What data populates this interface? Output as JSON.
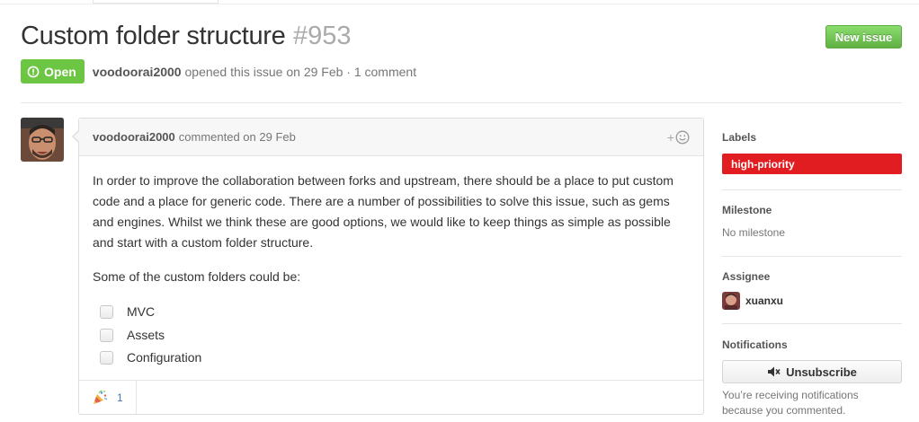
{
  "issue": {
    "title": "Custom folder structure",
    "number": "#953",
    "state": "Open",
    "author": "voodoorai2000",
    "opened_text": "opened this issue on 29 Feb · 1 comment"
  },
  "header": {
    "new_issue_label": "New issue"
  },
  "comment": {
    "author": "voodoorai2000",
    "meta": "commented on 29 Feb",
    "paragraphs": [
      "In order to improve the collaboration between forks and upstream, there should be a place to put custom code and a place for generic code. There are a number of possibilities to solve this issue, such as gems and engines. Whilst we think these are good options, we would like to keep things as simple as possible and start with a custom folder structure.",
      "Some of the custom folders could be:"
    ],
    "tasks": [
      {
        "label": "MVC",
        "checked": false
      },
      {
        "label": "Assets",
        "checked": false
      },
      {
        "label": "Configuration",
        "checked": false
      }
    ],
    "reaction_plus": "+",
    "reactions": [
      {
        "icon": "tada-icon",
        "count": "1"
      }
    ]
  },
  "sidebar": {
    "labels": {
      "heading": "Labels",
      "items": [
        {
          "name": "high-priority",
          "color": "#e11d21"
        }
      ]
    },
    "milestone": {
      "heading": "Milestone",
      "value": "No milestone"
    },
    "assignee": {
      "heading": "Assignee",
      "name": "xuanxu"
    },
    "notifications": {
      "heading": "Notifications",
      "button_label": "Unsubscribe",
      "reason": "You’re receiving notifications because you commented."
    }
  },
  "colors": {
    "open_green": "#6cc644",
    "new_issue_green": "#60b044",
    "label_red": "#e11d21",
    "link_blue": "#4078c0"
  }
}
